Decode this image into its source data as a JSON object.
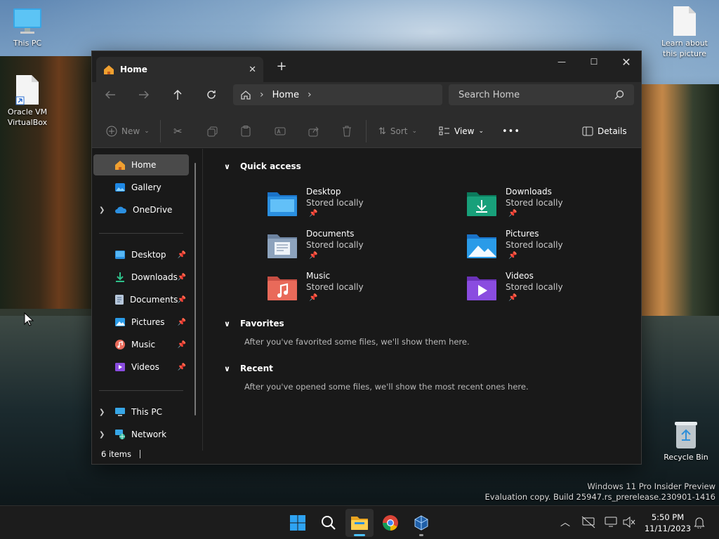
{
  "desktop": {
    "icons": [
      {
        "label": "This PC"
      },
      {
        "label": "Oracle VM\nVirtualBox"
      },
      {
        "label": "Learn about\nthis picture"
      },
      {
        "label": "Recycle Bin"
      }
    ],
    "watermark": {
      "line1": "Windows 11 Pro Insider Preview",
      "line2": "Evaluation copy. Build 25947.rs_prerelease.230901-1416"
    }
  },
  "window": {
    "tab": {
      "title": "Home",
      "close_glyph": "✕"
    },
    "new_tab_glyph": "+",
    "controls": {
      "minimize": "—",
      "maximize": "☐",
      "close": "✕"
    },
    "address": {
      "crumb": "Home",
      "sep": "›"
    },
    "search": {
      "placeholder": "Search Home"
    },
    "commands": {
      "new": "New",
      "sort": "Sort",
      "view": "View",
      "more": "•••",
      "details": "Details"
    },
    "nav": {
      "top": [
        {
          "label": "Home",
          "icon": "home-icon",
          "selected": true
        },
        {
          "label": "Gallery",
          "icon": "gallery-icon"
        },
        {
          "label": "OneDrive",
          "icon": "onedrive-icon"
        }
      ],
      "pinned": [
        {
          "label": "Desktop",
          "icon": "desktop-folder-icon"
        },
        {
          "label": "Downloads",
          "icon": "downloads-folder-icon"
        },
        {
          "label": "Documents",
          "icon": "documents-folder-icon"
        },
        {
          "label": "Pictures",
          "icon": "pictures-folder-icon"
        },
        {
          "label": "Music",
          "icon": "music-folder-icon"
        },
        {
          "label": "Videos",
          "icon": "videos-folder-icon"
        }
      ],
      "bottom": [
        {
          "label": "This PC",
          "icon": "computer-icon"
        },
        {
          "label": "Network",
          "icon": "network-icon"
        }
      ],
      "pin_glyph": "📌"
    },
    "sections": {
      "quick_access": "Quick access",
      "favorites": "Favorites",
      "favorites_empty": "After you've favorited some files, we'll show them here.",
      "recent": "Recent",
      "recent_empty": "After you've opened some files, we'll show the most recent ones here."
    },
    "quick_access_items": [
      {
        "name": "Desktop",
        "sub": "Stored locally",
        "color": "#2a8fe0"
      },
      {
        "name": "Downloads",
        "sub": "Stored locally",
        "color": "#18a07a"
      },
      {
        "name": "Documents",
        "sub": "Stored locally",
        "color": "#8da3bd"
      },
      {
        "name": "Pictures",
        "sub": "Stored locally",
        "color": "#2a9be8"
      },
      {
        "name": "Music",
        "sub": "Stored locally",
        "color": "#e96a5a"
      },
      {
        "name": "Videos",
        "sub": "Stored locally",
        "color": "#8a4ce0"
      }
    ],
    "status": {
      "count": "6 items"
    }
  },
  "taskbar": {
    "clock_time": "5:50 PM",
    "clock_date": "11/11/2023",
    "tray_chevron": "︿"
  }
}
